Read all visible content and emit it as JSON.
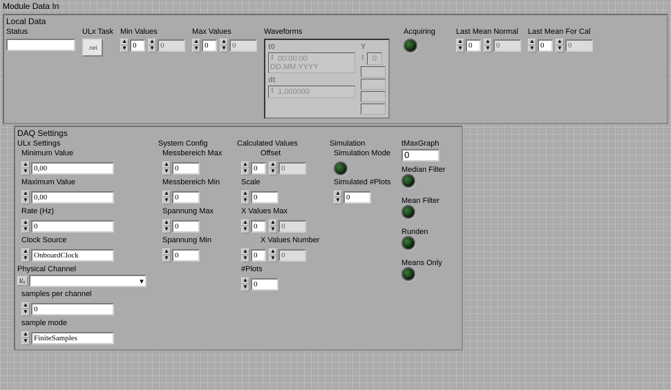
{
  "title": "Module Data In",
  "local": {
    "caption": "Local Data",
    "status_lbl": "Status",
    "ulx_task_lbl": "ULx Task",
    "ulx_task_icon": ".net",
    "minvals_lbl": "Min Values",
    "maxvals_lbl": "Max Values",
    "idx0": "0",
    "gray0": "0",
    "waveforms_lbl": "Waveforms",
    "wave": {
      "t0_lbl": "t0",
      "t0_time": "00:00:00",
      "t0_date": "DD.MM.YYYY",
      "dt_lbl": "dt",
      "dt_val": "1,000000",
      "y_lbl": "Y",
      "y0": "0"
    },
    "acquiring_lbl": "Acquiring",
    "last_mean_normal_lbl": "Last Mean Normal",
    "last_mean_cal_lbl": "Last Mean For Cal"
  },
  "daq": {
    "caption": "DAQ Settings",
    "ulx": {
      "caption": "ULx Settings",
      "min_lbl": "Minimum Value",
      "min_val": "0,00",
      "max_lbl": "Maximum Value",
      "max_val": "0,00",
      "rate_lbl": "Rate (Hz)",
      "rate_val": "0",
      "clock_lbl": "Clock Source",
      "clock_val": "OnboardClock",
      "phys_lbl": "Physical Channel",
      "phys_val": "",
      "spc_lbl": "samples per channel",
      "spc_val": "0",
      "mode_lbl": "sample mode",
      "mode_val": "FiniteSamples"
    },
    "sys": {
      "caption": "System Config",
      "mbmax_lbl": "Messbereich Max",
      "mbmax_val": "0",
      "mbmin_lbl": "Messbereich Min",
      "mbmin_val": "0",
      "spmax_lbl": "Spannung Max",
      "spmax_val": "0",
      "spmin_lbl": "Spannung Min",
      "spmin_val": "0"
    },
    "calc": {
      "caption": "Calculated Values",
      "offset_lbl": "Offset",
      "scale_lbl": "Scale",
      "scale_val": "0",
      "xmax_lbl": "X Values Max",
      "xnum_lbl": "X Values Number",
      "plots_lbl": "#Plots",
      "idx0": "0",
      "gray0": "0"
    },
    "sim": {
      "caption": "Simulation",
      "mode_lbl": "Simulation Mode",
      "plots_lbl": "Simulated #Plots",
      "plots_val": "0"
    },
    "tmax": {
      "caption": "tMaxGraph",
      "val": "0",
      "median_lbl": "Median Filter",
      "mean_lbl": "Mean Filter",
      "runden_lbl": "Runden",
      "means_only_lbl": "Means Only"
    }
  }
}
